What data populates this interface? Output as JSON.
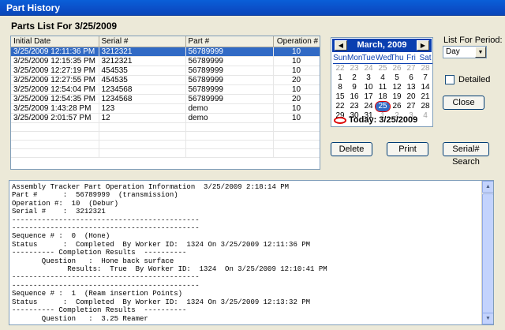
{
  "window": {
    "title": "Part History"
  },
  "header": {
    "title": "Parts List For 3/25/2009"
  },
  "grid": {
    "columns": [
      "Initial Date",
      "Serial #",
      "Part #",
      "Operation #"
    ],
    "rows": [
      [
        "3/25/2009 12:11:36 PM",
        "3212321",
        "56789999",
        "10"
      ],
      [
        "3/25/2009 12:15:35 PM",
        "3212321",
        "56789999",
        "10"
      ],
      [
        "3/25/2009 12:27:19 PM",
        "454535",
        "56789999",
        "10"
      ],
      [
        "3/25/2009 12:27:55 PM",
        "454535",
        "56789999",
        "20"
      ],
      [
        "3/25/2009 12:54:04 PM",
        "1234568",
        "56789999",
        "10"
      ],
      [
        "3/25/2009 12:54:35 PM",
        "1234568",
        "56789999",
        "20"
      ],
      [
        "3/25/2009 1:43:28 PM",
        "123",
        "demo",
        "10"
      ],
      [
        "3/25/2009 2:01:57 PM",
        "12",
        "demo",
        "10"
      ]
    ],
    "selected_index": 0
  },
  "calendar": {
    "title": "March, 2009",
    "dow": [
      "Sun",
      "Mon",
      "Tue",
      "Wed",
      "Thu",
      "Fri",
      "Sat"
    ],
    "weeks": [
      [
        "22",
        "23",
        "24",
        "25",
        "26",
        "27",
        "28"
      ],
      [
        "1",
        "2",
        "3",
        "4",
        "5",
        "6",
        "7"
      ],
      [
        "8",
        "9",
        "10",
        "11",
        "12",
        "13",
        "14"
      ],
      [
        "15",
        "16",
        "17",
        "18",
        "19",
        "20",
        "21"
      ],
      [
        "22",
        "23",
        "24",
        "25",
        "26",
        "27",
        "28"
      ],
      [
        "29",
        "30",
        "31",
        "1",
        "2",
        "3",
        "4"
      ]
    ],
    "today_label": "Today: 3/25/2009"
  },
  "period": {
    "label": "List For Period:",
    "value": "Day"
  },
  "detailed": {
    "label": "Detailed"
  },
  "buttons": {
    "close": "Close",
    "delete": "Delete",
    "print": "Print",
    "serial_search": "Serial# Search"
  },
  "report": {
    "lines": [
      "Assembly Tracker Part Operation Information  3/25/2009 2:18:14 PM",
      "Part #      :  56789999  (transmission)",
      "Operation #:  10  (Debur)",
      "Serial #    :  3212321",
      "--------------------------------------------",
      "--------------------------------------------",
      "Sequence # :  0  (Hone)",
      "Status      :  Completed  By Worker ID:  1324 On 3/25/2009 12:11:36 PM",
      "---------- Completion Results  ----------",
      "       Question   :  Hone back surface",
      "             Results:  True  By Worker ID:  1324  On 3/25/2009 12:10:41 PM",
      "--------------------------------------------",
      "--------------------------------------------",
      "Sequence # :  1  (Ream insertion Points)",
      "Status      :  Completed  By Worker ID:  1324 On 3/25/2009 12:13:32 PM",
      "---------- Completion Results  ----------",
      "       Question   :  3.25 Reamer"
    ]
  }
}
